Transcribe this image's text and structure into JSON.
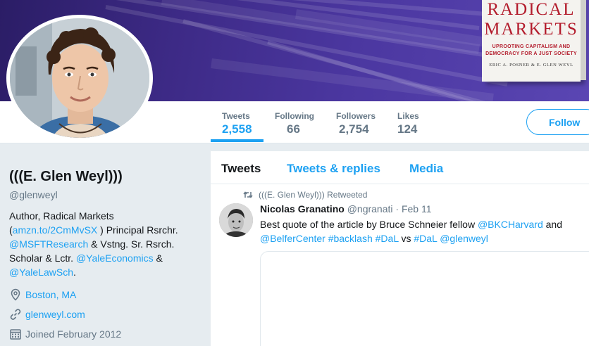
{
  "banner": {
    "book_title_line1": "RADICAL",
    "book_title_line2": "MARKETS",
    "book_subtitle_line1": "UPROOTING CAPITALISM AND",
    "book_subtitle_line2": "DEMOCRACY FOR A JUST SOCIETY",
    "book_authors": "ERIC A. POSNER & E. GLEN WEYL"
  },
  "stats": [
    {
      "label": "Tweets",
      "value": "2,558"
    },
    {
      "label": "Following",
      "value": "66"
    },
    {
      "label": "Followers",
      "value": "2,754"
    },
    {
      "label": "Likes",
      "value": "124"
    }
  ],
  "follow_label": "Follow",
  "profile": {
    "name": "(((E. Glen Weyl)))",
    "handle": "@glenweyl",
    "bio": {
      "part1": "Author, Radical Markets (",
      "link1": "amzn.to/2CmMvSX",
      "part2": " ) Principal Rsrchr. ",
      "link2": "@MSFTResearch",
      "part3": " & Vstng. Sr. Rsrch. Scholar & Lctr. ",
      "link3": "@YaleEconomics",
      "part4": " & ",
      "link4": "@YaleLawSch",
      "part5": "."
    },
    "location": "Boston, MA",
    "website": "glenweyl.com",
    "joined": "Joined February 2012"
  },
  "timeline": {
    "tabs": [
      "Tweets",
      "Tweets & replies",
      "Media"
    ],
    "retweet_context": "(((E. Glen Weyl))) Retweeted",
    "tweet": {
      "name": "Nicolas Granatino",
      "handle": "@ngranati",
      "date": "· Feb 11",
      "text": {
        "t1": "Best quote of the article by Bruce Schneier fellow ",
        "l1": "@BKCHarvard",
        "t2": " and ",
        "l2": "@BelferCenter",
        "t3": " ",
        "l3": "#backlash",
        "t4": " ",
        "l4": "#DaL",
        "t5": " vs ",
        "l5": "#DaL",
        "t6": " ",
        "l6": "@glenweyl"
      }
    }
  },
  "colors": {
    "accent": "#1da1f2",
    "banner": "#4b37a0",
    "book_red": "#b31c2c"
  },
  "icons": [
    "retweet-icon",
    "location-icon",
    "link-icon",
    "calendar-icon"
  ]
}
